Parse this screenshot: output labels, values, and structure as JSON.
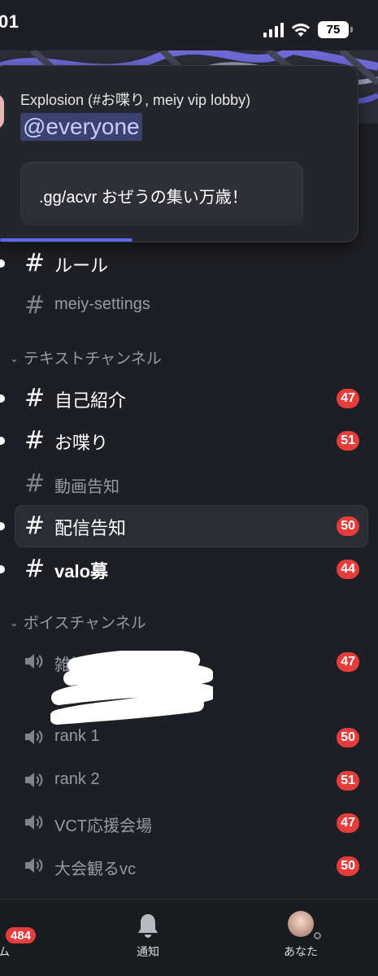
{
  "status_bar": {
    "time": "01",
    "battery": "75"
  },
  "popup": {
    "title": "Explosion (#お喋り, meiy vip lobby)",
    "mention": "@everyone",
    "embed_text": ".gg/acvr おぜうの集い万歳！",
    "progress_fraction": 0.35
  },
  "channels": {
    "rules": {
      "name": "ルール",
      "unread": true
    },
    "settings": {
      "name": "meiy-settings"
    },
    "text_category": "テキストチャンネル",
    "text": [
      {
        "name": "自己紹介",
        "badge": "47",
        "unread": true
      },
      {
        "name": "お喋り",
        "badge": "51",
        "unread": true
      },
      {
        "name": "動画告知",
        "badge": "",
        "unread": false
      },
      {
        "name": "配信告知",
        "badge": "50",
        "unread": true,
        "selected": true
      },
      {
        "name": "valo募",
        "badge": "44",
        "unread": true
      }
    ],
    "voice_category": "ボイスチャンネル",
    "voice": [
      {
        "name": "雑談",
        "badge": "47"
      },
      {
        "name": "rank 1",
        "badge": "50"
      },
      {
        "name": "rank 2",
        "badge": "51"
      },
      {
        "name": "VCT応援会場",
        "badge": "47"
      },
      {
        "name": "大会観るvc",
        "badge": "50"
      }
    ]
  },
  "bottom_nav": {
    "home_label": "ム",
    "home_badge": "484",
    "notifications_label": "通知",
    "you_label": "あなた"
  },
  "colors": {
    "background": "#1e1f24",
    "mention_badge": "#e53c3c",
    "blurple": "#5865f2"
  }
}
